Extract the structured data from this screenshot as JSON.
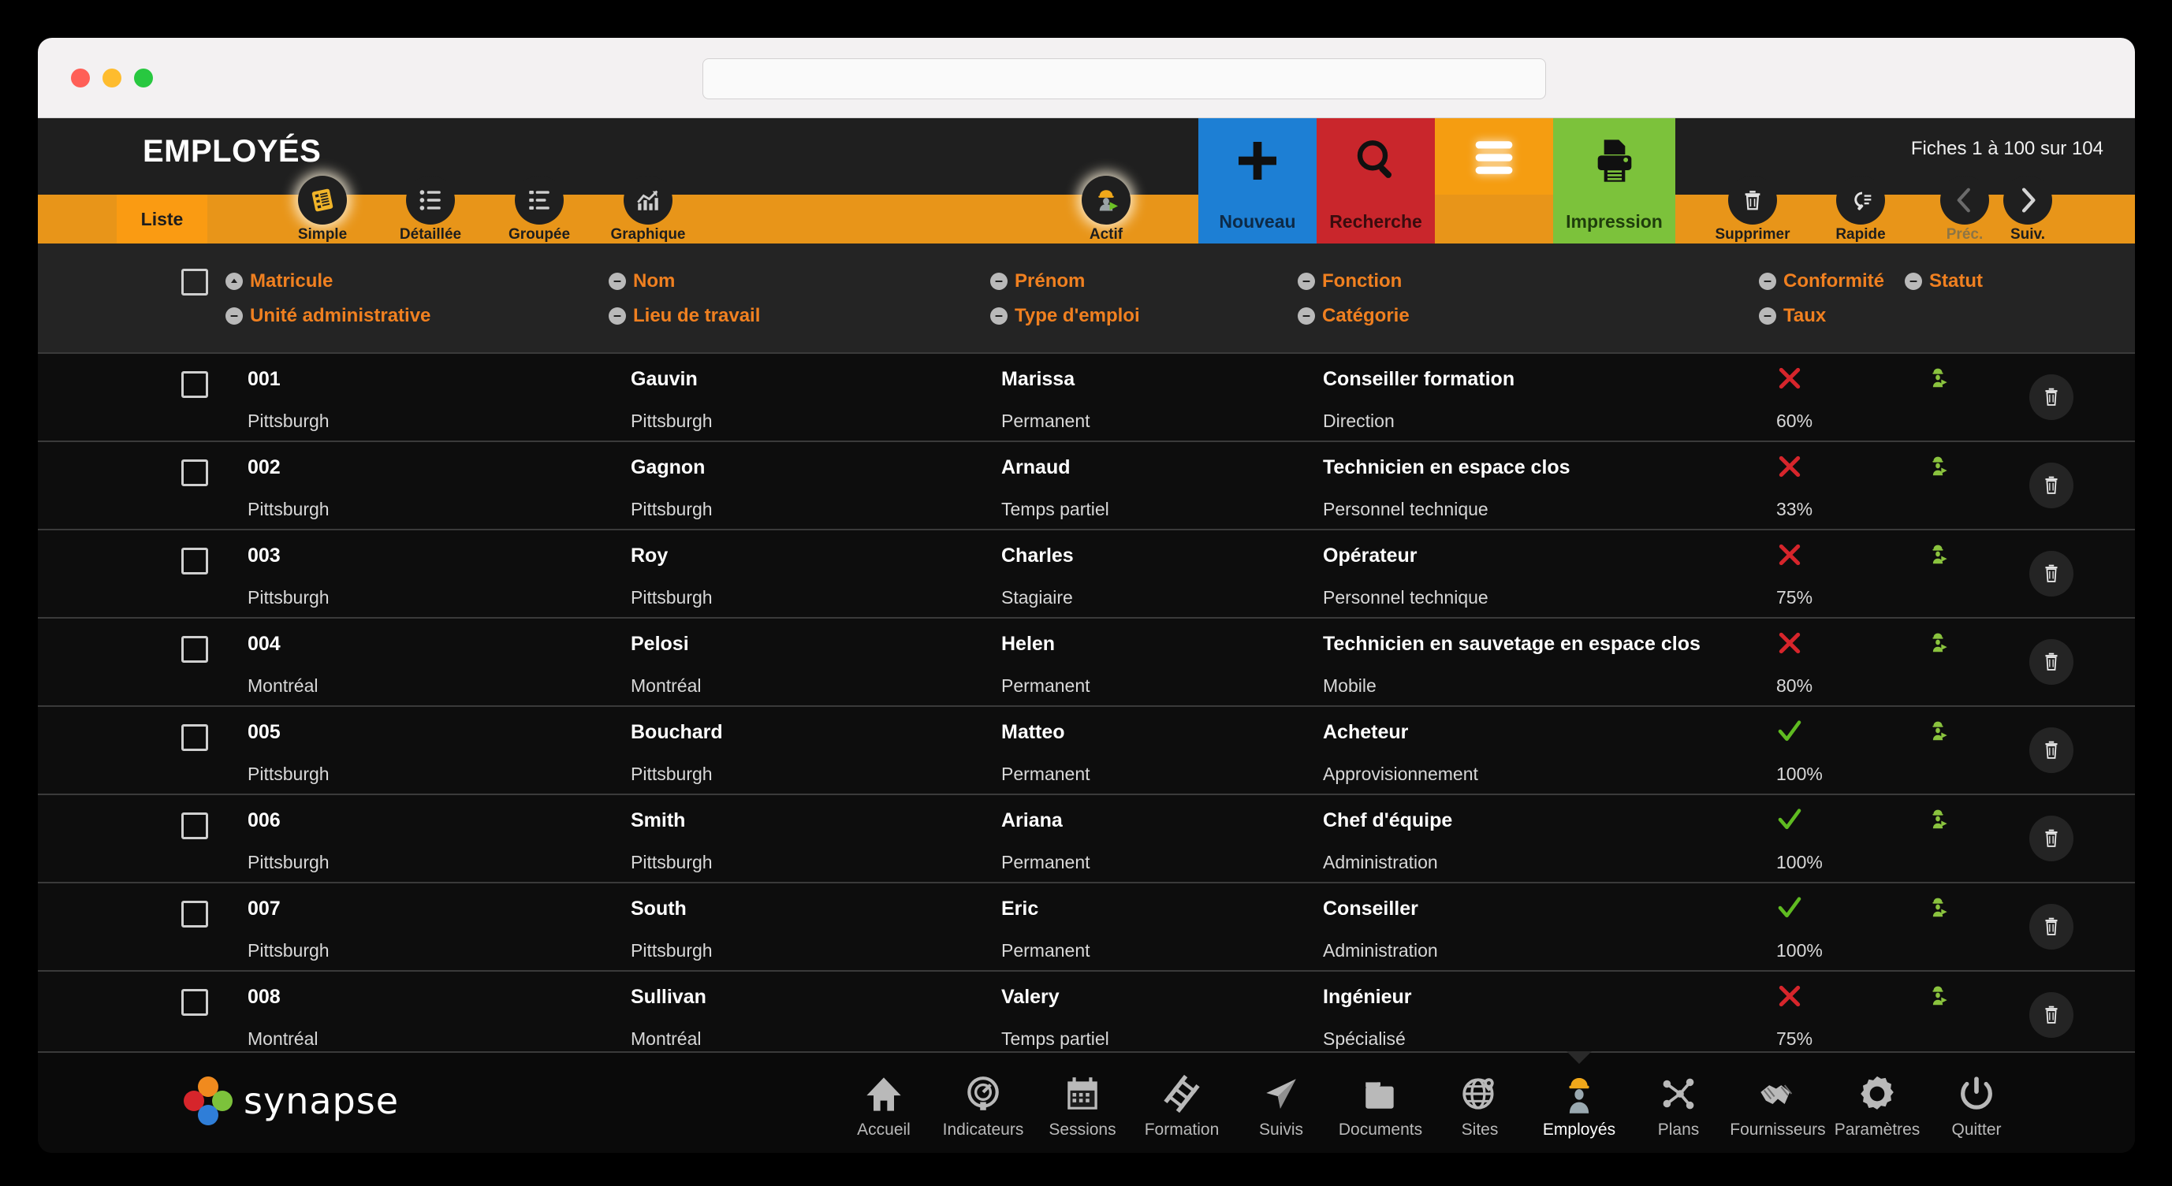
{
  "browser": {
    "address_value": "",
    "address_placeholder": ""
  },
  "header": {
    "title": "EMPLOYÉS",
    "record_count": "Fiches 1 à 100 sur 104",
    "tab_liste": "Liste",
    "view_modes": [
      {
        "label": "Simple",
        "icon": "list-card-icon",
        "active": true
      },
      {
        "label": "Détaillée",
        "icon": "detailed-list-icon",
        "active": false
      },
      {
        "label": "Groupée",
        "icon": "grouped-list-icon",
        "active": false
      },
      {
        "label": "Graphique",
        "icon": "chart-icon",
        "active": false
      }
    ],
    "actif_toggle": {
      "label": "Actif",
      "icon": "worker-play-icon"
    },
    "action_tiles": [
      {
        "label": "Nouveau",
        "icon": "plus-icon",
        "color": "#1d7fd4"
      },
      {
        "label": "Recherche",
        "icon": "magnifier-icon",
        "color": "#c9262c"
      },
      {
        "label": "",
        "icon": "hamburger-menu-icon",
        "color": "#f59d11"
      },
      {
        "label": "Impression",
        "icon": "printer-icon",
        "color": "#7cc23b"
      }
    ],
    "right_buttons": [
      {
        "label": "Supprimer",
        "icon": "trash-icon",
        "disabled": false
      },
      {
        "label": "Rapide",
        "icon": "quick-search-icon",
        "disabled": false
      },
      {
        "label": "Préc.",
        "icon": "chevron-left-icon",
        "disabled": true
      },
      {
        "label": "Suiv.",
        "icon": "chevron-right-icon",
        "disabled": false
      }
    ]
  },
  "columns": {
    "row1": [
      {
        "label": "Matricule",
        "sort": "asc"
      },
      {
        "label": "Nom",
        "sort": "none"
      },
      {
        "label": "Prénom",
        "sort": "none"
      },
      {
        "label": "Fonction",
        "sort": "none"
      },
      {
        "label": "Conformité",
        "sort": "none"
      },
      {
        "label": "Statut",
        "sort": "none"
      }
    ],
    "row2": [
      {
        "label": "Unité administrative",
        "sort": "none"
      },
      {
        "label": "Lieu de travail",
        "sort": "none"
      },
      {
        "label": "Type d'emploi",
        "sort": "none"
      },
      {
        "label": "Catégorie",
        "sort": "none"
      },
      {
        "label": "Taux",
        "sort": "none"
      }
    ]
  },
  "rows": [
    {
      "matricule": "001",
      "unite": "Pittsburgh",
      "nom": "Gauvin",
      "lieu": "Pittsburgh",
      "prenom": "Marissa",
      "type_emploi": "Permanent",
      "fonction": "Conseiller formation",
      "categorie": "Direction",
      "conformite": "no",
      "taux": "60%",
      "statut": "active-worker"
    },
    {
      "matricule": "002",
      "unite": "Pittsburgh",
      "nom": "Gagnon",
      "lieu": "Pittsburgh",
      "prenom": "Arnaud",
      "type_emploi": "Temps partiel",
      "fonction": "Technicien en espace clos",
      "categorie": "Personnel technique",
      "conformite": "no",
      "taux": "33%",
      "statut": "active-worker"
    },
    {
      "matricule": "003",
      "unite": "Pittsburgh",
      "nom": "Roy",
      "lieu": "Pittsburgh",
      "prenom": "Charles",
      "type_emploi": "Stagiaire",
      "fonction": "Opérateur",
      "categorie": "Personnel technique",
      "conformite": "no",
      "taux": "75%",
      "statut": "active-worker"
    },
    {
      "matricule": "004",
      "unite": "Montréal",
      "nom": "Pelosi",
      "lieu": "Montréal",
      "prenom": "Helen",
      "type_emploi": "Permanent",
      "fonction": "Technicien en sauvetage en espace clos",
      "categorie": "Mobile",
      "conformite": "no",
      "taux": "80%",
      "statut": "active-worker"
    },
    {
      "matricule": "005",
      "unite": "Pittsburgh",
      "nom": "Bouchard",
      "lieu": "Pittsburgh",
      "prenom": "Matteo",
      "type_emploi": "Permanent",
      "fonction": "Acheteur",
      "categorie": "Approvisionnement",
      "conformite": "yes",
      "taux": "100%",
      "statut": "active-worker"
    },
    {
      "matricule": "006",
      "unite": "Pittsburgh",
      "nom": "Smith",
      "lieu": "Pittsburgh",
      "prenom": "Ariana",
      "type_emploi": "Permanent",
      "fonction": "Chef d'équipe",
      "categorie": "Administration",
      "conformite": "yes",
      "taux": "100%",
      "statut": "active-worker"
    },
    {
      "matricule": "007",
      "unite": "Pittsburgh",
      "nom": "South",
      "lieu": "Pittsburgh",
      "prenom": "Eric",
      "type_emploi": "Permanent",
      "fonction": "Conseiller",
      "categorie": "Administration",
      "conformite": "yes",
      "taux": "100%",
      "statut": "active-worker"
    },
    {
      "matricule": "008",
      "unite": "Montréal",
      "nom": "Sullivan",
      "lieu": "Montréal",
      "prenom": "Valery",
      "type_emploi": "Temps partiel",
      "fonction": "Ingénieur",
      "categorie": "Spécialisé",
      "conformite": "no",
      "taux": "75%",
      "statut": "active-worker"
    }
  ],
  "footer": {
    "brand": "synapse",
    "nav": [
      {
        "label": "Accueil",
        "icon": "home-icon",
        "active": false
      },
      {
        "label": "Indicateurs",
        "icon": "gauge-icon",
        "active": false
      },
      {
        "label": "Sessions",
        "icon": "calendar-icon",
        "active": false
      },
      {
        "label": "Formation",
        "icon": "ladder-icon",
        "active": false
      },
      {
        "label": "Suivis",
        "icon": "paper-plane-icon",
        "active": false
      },
      {
        "label": "Documents",
        "icon": "folder-icon",
        "active": false
      },
      {
        "label": "Sites",
        "icon": "globe-pin-icon",
        "active": false
      },
      {
        "label": "Employés",
        "icon": "worker-icon",
        "active": true
      },
      {
        "label": "Plans",
        "icon": "network-icon",
        "active": false
      },
      {
        "label": "Fournisseurs",
        "icon": "handshake-icon",
        "active": false
      },
      {
        "label": "Paramètres",
        "icon": "gear-icon",
        "active": false
      },
      {
        "label": "Quitter",
        "icon": "power-icon",
        "active": false
      }
    ]
  },
  "colors": {
    "accent_orange": "#f08020",
    "band_orange": "#e89519",
    "tab_orange": "#fa9b12",
    "blue": "#1d7fd4",
    "red": "#c9262c",
    "green": "#7cc23b",
    "conformity_yes": "#5fbb21",
    "conformity_no": "#d6252b",
    "status_green": "#8ac33e"
  }
}
